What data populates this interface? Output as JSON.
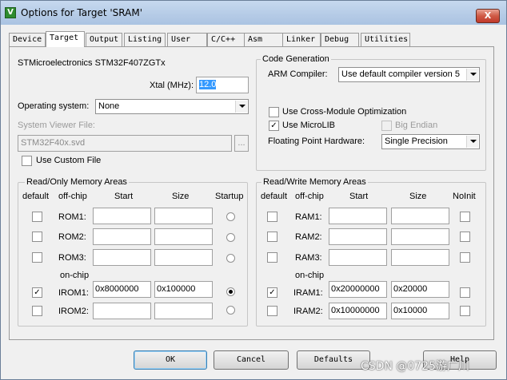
{
  "window": {
    "title": "Options for Target 'SRAM'",
    "app_icon_glyph": "V",
    "close_glyph": "X"
  },
  "tabs": [
    {
      "label": "Device"
    },
    {
      "label": "Target"
    },
    {
      "label": "Output"
    },
    {
      "label": "Listing"
    },
    {
      "label": "User"
    },
    {
      "label": "C/C++"
    },
    {
      "label": "Asm"
    },
    {
      "label": "Linker"
    },
    {
      "label": "Debug"
    },
    {
      "label": "Utilities"
    }
  ],
  "active_tab": "Target",
  "target": {
    "device_name": "STMicroelectronics STM32F407ZGTx",
    "xtal_label": "Xtal (MHz):",
    "xtal_value": "12.0",
    "os_label": "Operating system:",
    "os_value": "None",
    "svf_label": "System Viewer File:",
    "svf_value": "STM32F40x.svd",
    "svf_browse": "...",
    "custom_file_label": "Use Custom File",
    "custom_file_checked": false
  },
  "code_generation": {
    "group_title": "Code Generation",
    "compiler_label": "ARM Compiler:",
    "compiler_value": "Use default compiler version 5",
    "cross_module_label": "Use Cross-Module Optimization",
    "cross_module_checked": false,
    "microlib_label": "Use MicroLIB",
    "microlib_checked": true,
    "big_endian_label": "Big Endian",
    "big_endian_checked": false,
    "fph_label": "Floating Point Hardware:",
    "fph_value": "Single Precision"
  },
  "check_mark": "✓",
  "ro_memory": {
    "group_title": "Read/Only Memory Areas",
    "headers": {
      "default": "default",
      "offchip": "off-chip",
      "start": "Start",
      "size": "Size",
      "flag": "Startup"
    },
    "onchip_label": "on-chip",
    "rows": [
      {
        "name": "ROM1:",
        "default": false,
        "start": "",
        "size": "",
        "startup": false
      },
      {
        "name": "ROM2:",
        "default": false,
        "start": "",
        "size": "",
        "startup": false
      },
      {
        "name": "ROM3:",
        "default": false,
        "start": "",
        "size": "",
        "startup": false
      },
      {
        "name": "IROM1:",
        "default": true,
        "start": "0x8000000",
        "size": "0x100000",
        "startup": true
      },
      {
        "name": "IROM2:",
        "default": false,
        "start": "",
        "size": "",
        "startup": false
      }
    ]
  },
  "rw_memory": {
    "group_title": "Read/Write Memory Areas",
    "headers": {
      "default": "default",
      "offchip": "off-chip",
      "start": "Start",
      "size": "Size",
      "flag": "NoInit"
    },
    "onchip_label": "on-chip",
    "rows": [
      {
        "name": "RAM1:",
        "default": false,
        "start": "",
        "size": "",
        "noinit": false
      },
      {
        "name": "RAM2:",
        "default": false,
        "start": "",
        "size": "",
        "noinit": false
      },
      {
        "name": "RAM3:",
        "default": false,
        "start": "",
        "size": "",
        "noinit": false
      },
      {
        "name": "IRAM1:",
        "default": true,
        "start": "0x20000000",
        "size": "0x20000",
        "noinit": false
      },
      {
        "name": "IRAM2:",
        "default": false,
        "start": "0x10000000",
        "size": "0x10000",
        "noinit": false
      }
    ]
  },
  "buttons": {
    "ok": "OK",
    "cancel": "Cancel",
    "defaults": "Defaults",
    "help": "Help"
  },
  "watermark": "CSDN @0725游广川"
}
